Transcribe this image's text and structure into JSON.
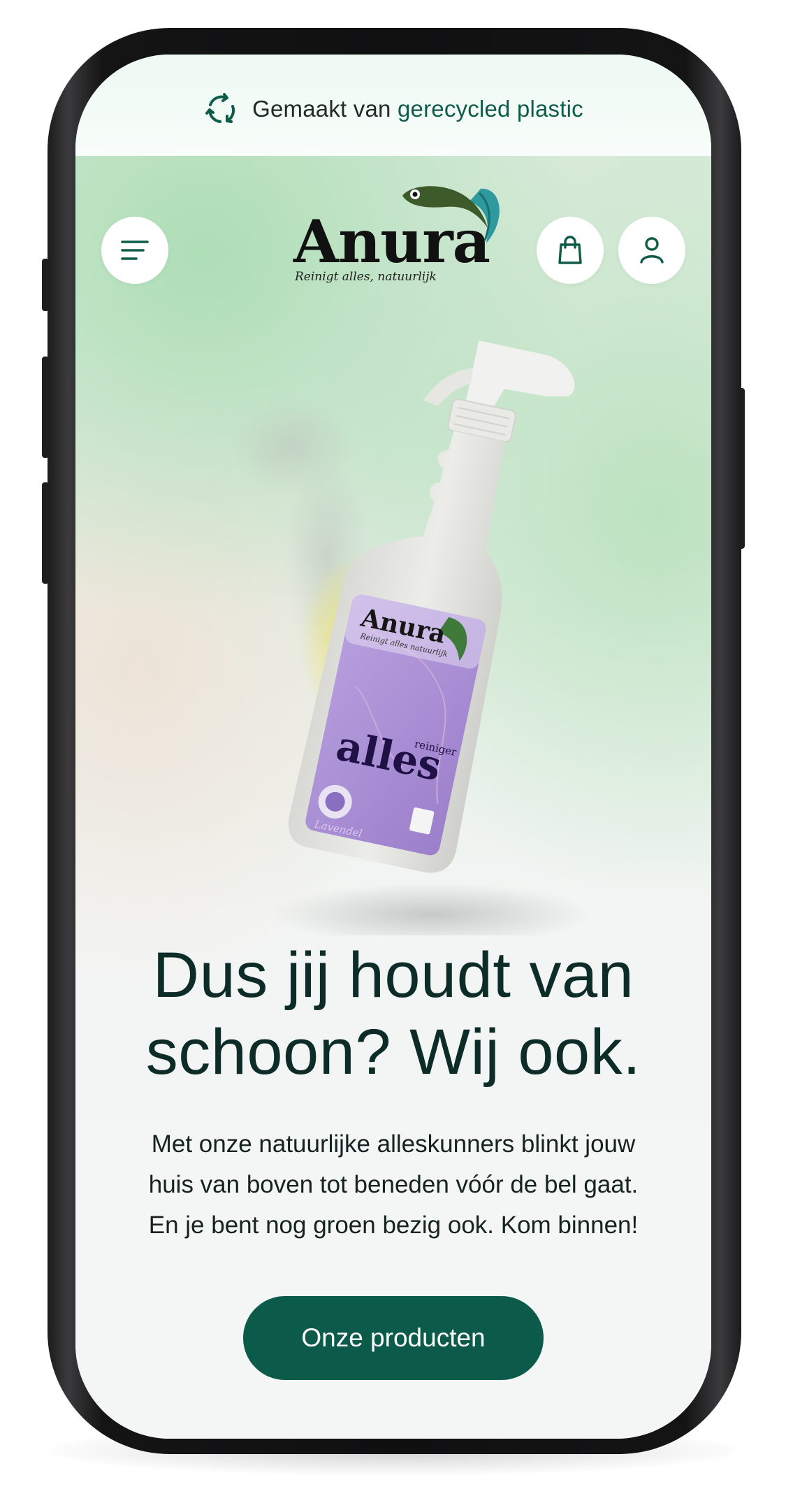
{
  "banner": {
    "text_prefix": "Gemaakt van",
    "text_highlight": "gerecycled plastic",
    "icon": "recycle-icon"
  },
  "header": {
    "menu_icon": "menu-icon",
    "brand_name": "Anura",
    "brand_tagline": "Reinigt alles, natuurlijk",
    "cart_icon": "shopping-bag-icon",
    "account_icon": "user-icon"
  },
  "product": {
    "label_brand": "Anura",
    "label_tagline": "Reinigt alles natuurlijk",
    "label_line1": "reiniger",
    "label_line2": "alles",
    "label_scent": "Lavendel"
  },
  "hero": {
    "headline_line1": "Dus jij houdt van",
    "headline_line2": "schoon? Wij ook.",
    "body_line1": "Met onze natuurlijke alleskunners blinkt jouw",
    "body_line2": "huis van boven tot beneden vóór de bel gaat.",
    "body_line3": "En je bent nog groen bezig ook. Kom binnen!",
    "cta_label": "Onze producten"
  },
  "colors": {
    "accent": "#0b5a4a",
    "highlight_text": "#0f5d49",
    "heading_text": "#0d2c27",
    "label_purple": "#a98fd3"
  }
}
